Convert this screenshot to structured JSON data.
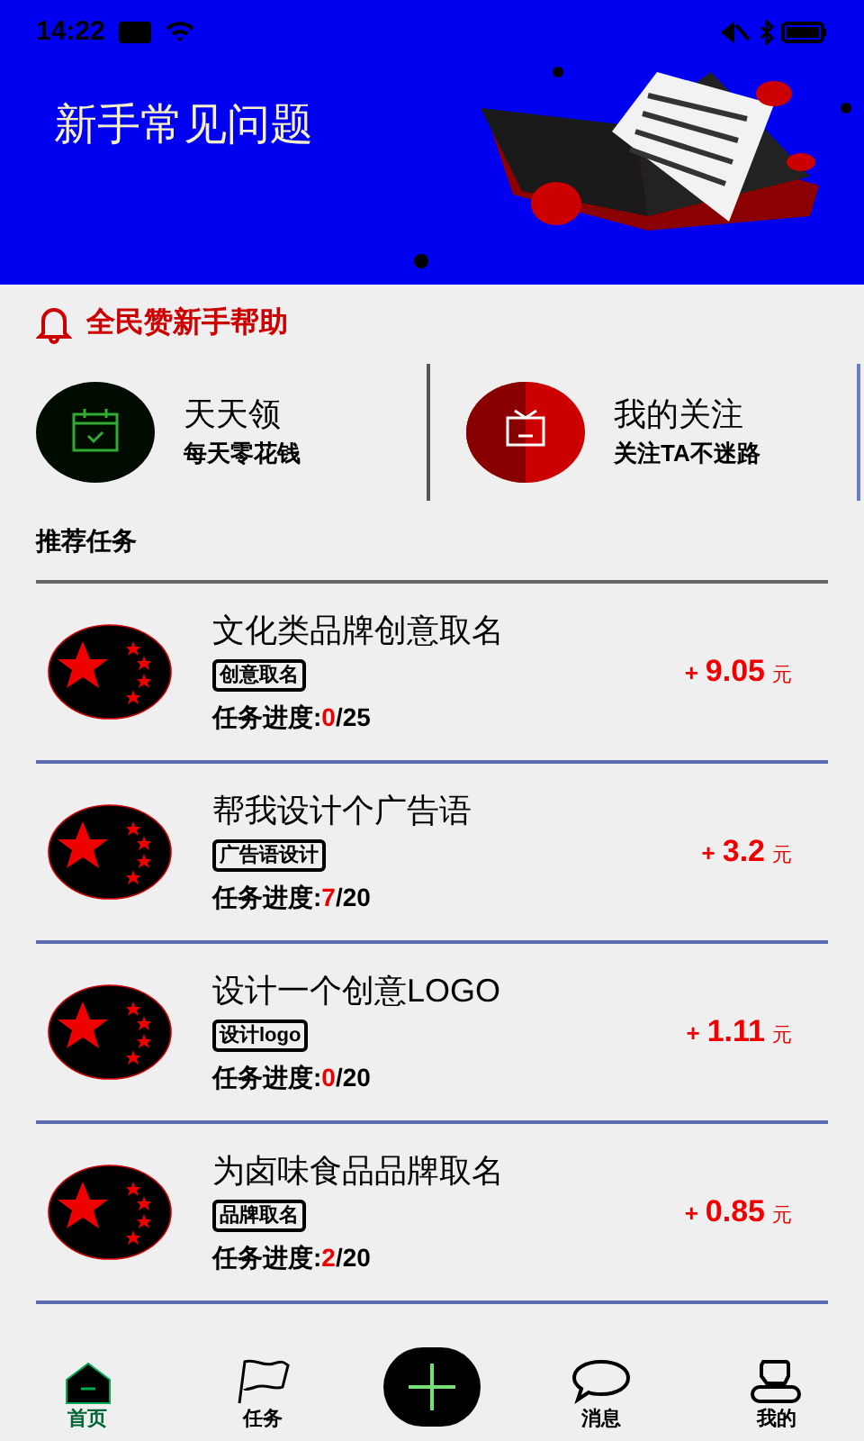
{
  "status_bar": {
    "time": "14:22"
  },
  "banner": {
    "title": "新手常见问题",
    "pager": [
      {
        "selected": true
      }
    ]
  },
  "notice": {
    "text": "全民赞新手帮助"
  },
  "shortcuts": [
    {
      "kind": "calendar",
      "title": "天天领",
      "subtitle": "每天零花钱"
    },
    {
      "kind": "gift",
      "title": "我的关注",
      "subtitle": "关注TA不迷路"
    }
  ],
  "section_title": "推荐任务",
  "tasks": [
    {
      "title": "文化类品牌创意取名",
      "tag": "创意取名",
      "progress_label": "任务进度:",
      "done": "0",
      "total": "/25",
      "reward_sign": "+",
      "reward": "9.05",
      "unit": "元"
    },
    {
      "title": "帮我设计个广告语",
      "tag": "广告语设计",
      "progress_label": "任务进度:",
      "done": "7",
      "total": "/20",
      "reward_sign": "+",
      "reward": "3.2",
      "unit": "元"
    },
    {
      "title": "设计一个创意LOGO",
      "tag": "设计logo",
      "progress_label": "任务进度:",
      "done": "0",
      "total": "/20",
      "reward_sign": "+",
      "reward": "1.11",
      "unit": "元"
    },
    {
      "title": "为卤味食品品牌取名",
      "tag": "品牌取名",
      "progress_label": "任务进度:",
      "done": "2",
      "total": "/20",
      "reward_sign": "+",
      "reward": "0.85",
      "unit": "元"
    }
  ],
  "tabs": [
    {
      "kind": "home",
      "label": "首页",
      "selected": true
    },
    {
      "kind": "flag",
      "label": "任务",
      "selected": false
    },
    {
      "kind": "plus"
    },
    {
      "kind": "chat",
      "label": "消息",
      "selected": false
    },
    {
      "kind": "user",
      "label": "我的",
      "selected": false
    }
  ]
}
